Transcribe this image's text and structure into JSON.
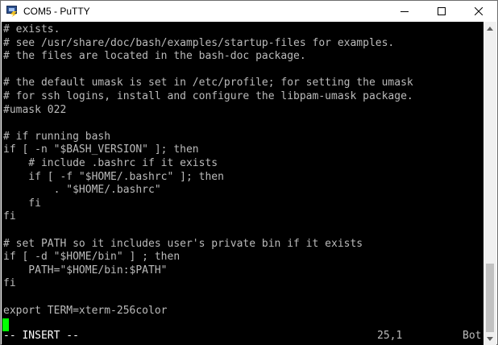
{
  "window": {
    "title": "COM5 - PuTTY",
    "app_icon": "putty-icon",
    "controls": [
      "minimize-icon",
      "maximize-icon",
      "close-icon"
    ]
  },
  "terminal": {
    "lines": [
      "# exists.",
      "# see /usr/share/doc/bash/examples/startup-files for examples.",
      "# the files are located in the bash-doc package.",
      "",
      "# the default umask is set in /etc/profile; for setting the umask",
      "# for ssh logins, install and configure the libpam-umask package.",
      "#umask 022",
      "",
      "# if running bash",
      "if [ -n \"$BASH_VERSION\" ]; then",
      "    # include .bashrc if it exists",
      "    if [ -f \"$HOME/.bashrc\" ]; then",
      "        . \"$HOME/.bashrc\"",
      "    fi",
      "fi",
      "",
      "# set PATH so it includes user's private bin if it exists",
      "if [ -d \"$HOME/bin\" ] ; then",
      "    PATH=\"$HOME/bin:$PATH\"",
      "fi",
      "",
      "export TERM=xterm-256color"
    ],
    "status": {
      "mode": "-- INSERT --",
      "position": "25,1",
      "scroll": "Bot"
    }
  },
  "scrollbar": {
    "position_fraction": 1.0
  }
}
